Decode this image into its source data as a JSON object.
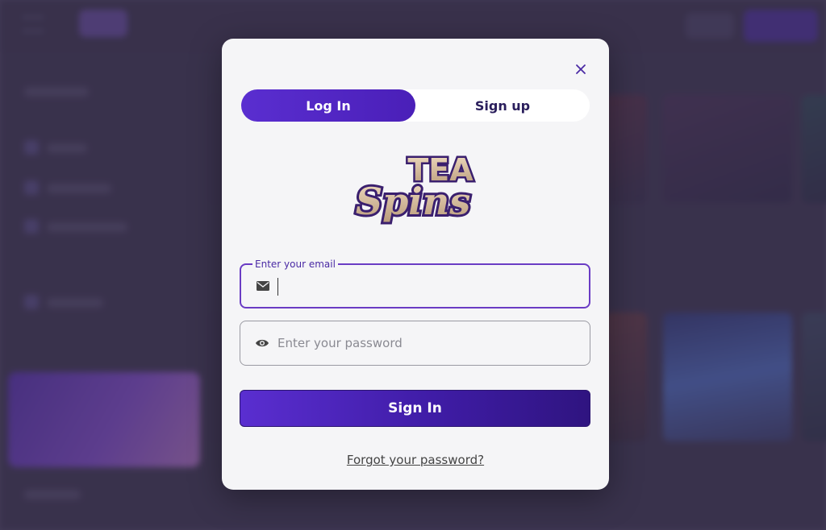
{
  "modal": {
    "close_icon": "close-icon",
    "tabs": [
      {
        "label": "Log In",
        "active": true
      },
      {
        "label": "Sign up",
        "active": false
      }
    ],
    "logo": {
      "line1": "TEA",
      "line2": "Spins"
    },
    "email": {
      "legend": "Enter your email",
      "value": "",
      "icon": "envelope-icon"
    },
    "password": {
      "placeholder": "Enter your password",
      "value": "",
      "icon": "eye-icon"
    },
    "sign_in_label": "Sign In",
    "forgot_label": "Forgot your password?"
  },
  "colors": {
    "accent": "#5a2ed0",
    "accent_dark": "#2f1480",
    "modal_bg": "#f5f5f7",
    "logo_fill": "#d8c0a0",
    "logo_outline": "#3a1f6e"
  }
}
